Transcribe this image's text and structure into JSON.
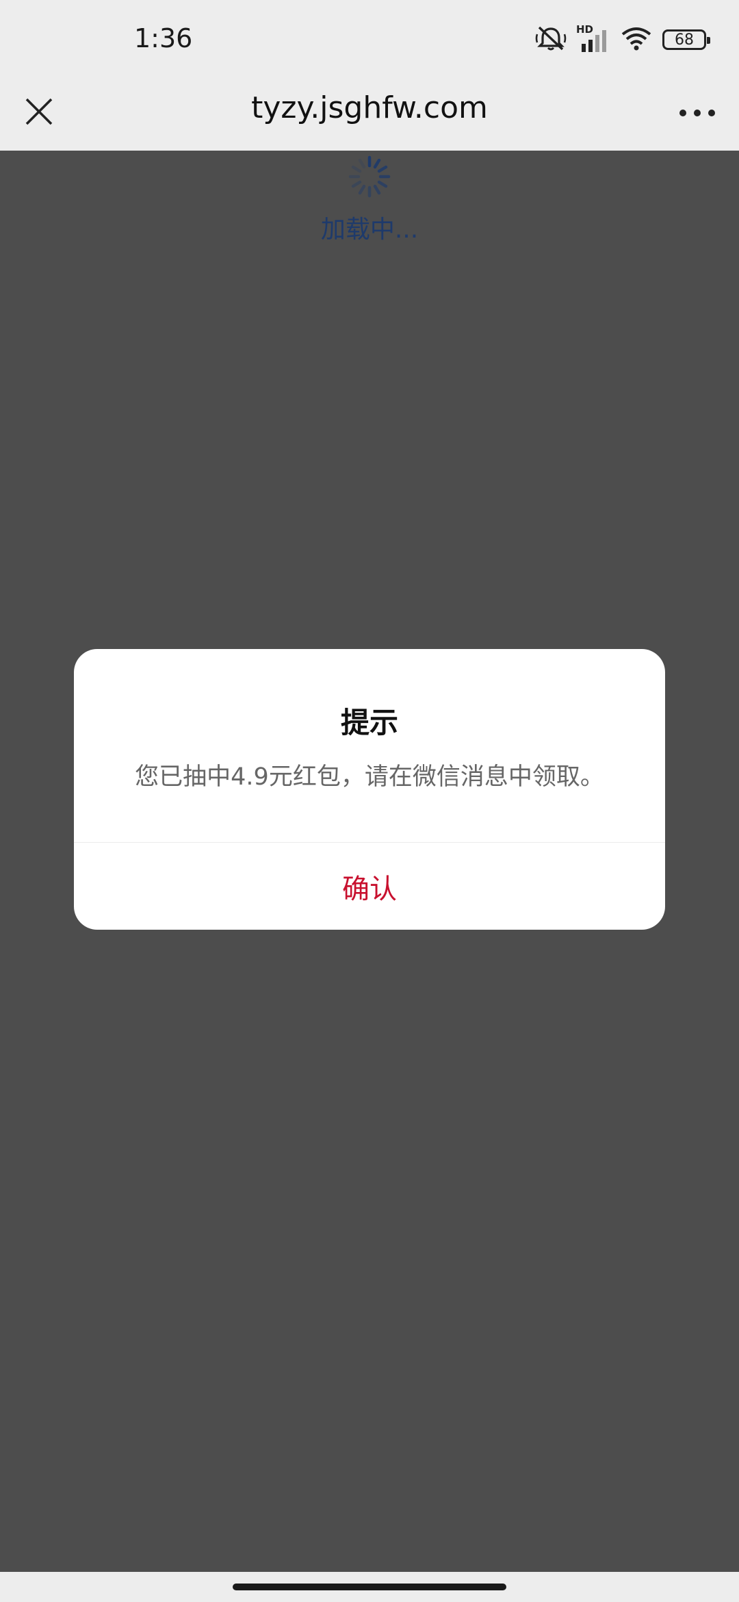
{
  "status_bar": {
    "time": "1:36",
    "network_label": "HD",
    "battery": "68",
    "icons": [
      "mute-icon",
      "signal-icon",
      "wifi-icon",
      "battery-icon"
    ]
  },
  "nav": {
    "title": "tyzy.jsghfw.com",
    "close_icon": "close-icon",
    "more_icon": "more-icon"
  },
  "page": {
    "loading_text": "加载中..."
  },
  "dialog": {
    "title": "提示",
    "message": "您已抽中4.9元红包，请在微信消息中领取。",
    "confirm_label": "确认"
  },
  "colors": {
    "overlay": "#4d4d4d",
    "bar_bg": "#ededed",
    "confirm": "#c8102e",
    "loading": "#1e3a6b"
  }
}
